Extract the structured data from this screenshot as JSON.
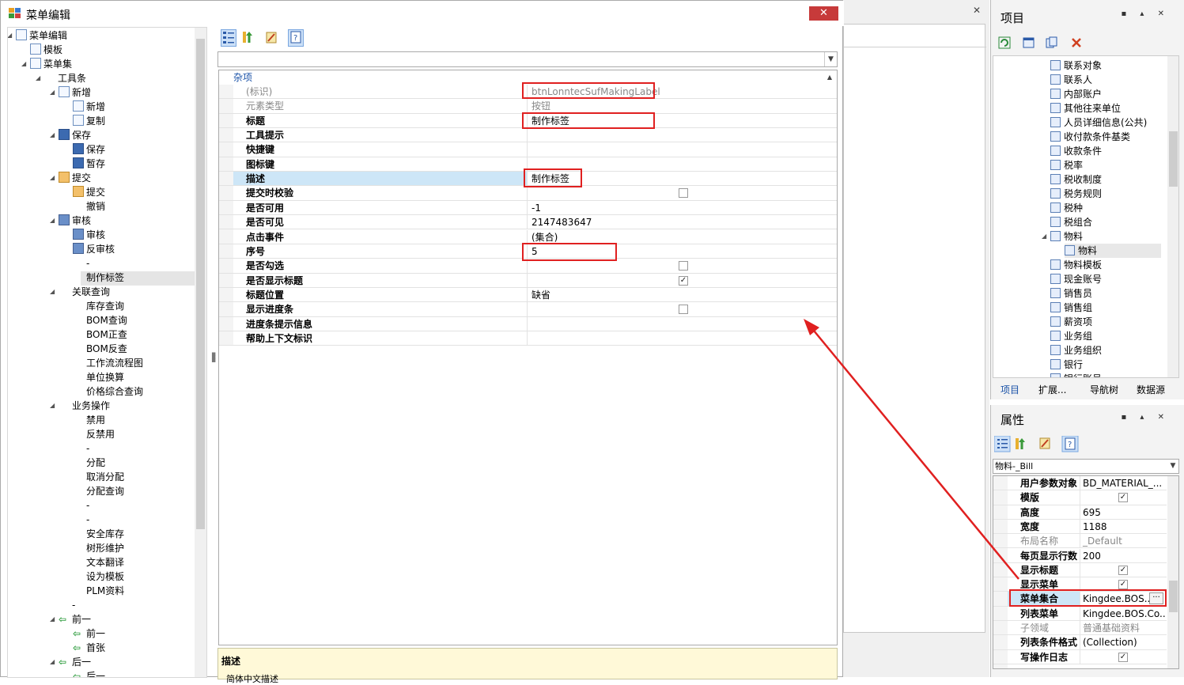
{
  "dialog": {
    "title": "菜单编辑",
    "close": "✕"
  },
  "tree": {
    "root": "菜单编辑",
    "template": "模板",
    "menuset": "菜单集",
    "toolbar": "工具条",
    "groups": [
      {
        "label": "新增",
        "children": [
          "新增",
          "复制"
        ]
      },
      {
        "label": "保存",
        "children": [
          "保存",
          "暂存"
        ]
      },
      {
        "label": "提交",
        "children": [
          "提交",
          "撤销"
        ]
      },
      {
        "label": "审核",
        "children": [
          "审核",
          "反审核",
          "-",
          "制作标签"
        ]
      },
      {
        "label": "关联查询",
        "children": [
          "库存查询",
          "BOM查询",
          "BOM正查",
          "BOM反查",
          "工作流流程图",
          "单位换算",
          "价格综合查询"
        ]
      },
      {
        "label": "业务操作",
        "children": [
          "禁用",
          "反禁用",
          "-",
          "分配",
          "取消分配",
          "分配查询",
          "-",
          "-",
          "安全库存",
          "树形维护",
          "文本翻译",
          "设为模板",
          "PLM资料"
        ]
      },
      {
        "label": "-",
        "children": []
      },
      {
        "label": "前一",
        "children": [
          "前一",
          "首张"
        ]
      },
      {
        "label": "后一",
        "children": [
          "后一"
        ]
      }
    ]
  },
  "property_grid": {
    "category": "杂项",
    "rows": [
      {
        "name": "(标识)",
        "value": "btnLonntecSufMakingLabel",
        "dim": true
      },
      {
        "name": "元素类型",
        "value": "按钮",
        "dim": true
      },
      {
        "name": "标题",
        "value": "制作标签"
      },
      {
        "name": "工具提示",
        "value": ""
      },
      {
        "name": "快捷键",
        "value": ""
      },
      {
        "name": "图标键",
        "value": ""
      },
      {
        "name": "描述",
        "value": "制作标签",
        "selected": true
      },
      {
        "name": "提交时校验",
        "value": "",
        "checkbox": false
      },
      {
        "name": "是否可用",
        "value": "-1"
      },
      {
        "name": "是否可见",
        "value": "2147483647"
      },
      {
        "name": "点击事件",
        "value": "(集合)"
      },
      {
        "name": "序号",
        "value": "5"
      },
      {
        "name": "是否勾选",
        "value": "",
        "checkbox": false
      },
      {
        "name": "是否显示标题",
        "value": "",
        "checkbox": true
      },
      {
        "name": "标题位置",
        "value": "缺省"
      },
      {
        "name": "显示进度条",
        "value": "",
        "checkbox": false
      },
      {
        "name": "进度条提示信息",
        "value": ""
      },
      {
        "name": "帮助上下文标识",
        "value": ""
      }
    ],
    "description_title": "描述",
    "description_text": "简体中文描述"
  },
  "project_panel": {
    "title": "项目",
    "pin_buttons": "▪ ▴ ✕",
    "items": [
      "联系对象",
      "联系人",
      "内部账户",
      "其他往来单位",
      "人员详细信息(公共)",
      "收付款条件基类",
      "收款条件",
      "税率",
      "税收制度",
      "税务规则",
      "税种",
      "税组合",
      "物料",
      "物料",
      "物料模板",
      "现金账号",
      "销售员",
      "销售组",
      "薪资项",
      "业务组",
      "业务组织",
      "银行",
      "银行账号"
    ],
    "tabs": [
      "项目",
      "扩展...",
      "导航树",
      "数据源"
    ]
  },
  "attr_panel": {
    "title": "属性",
    "pin_buttons": "▪ ▴ ✕",
    "object": "物料-_Bill",
    "rows": [
      {
        "name": "用户参数对象",
        "value": "BD_MATERIAL_..."
      },
      {
        "name": "模版",
        "value": "",
        "checkbox": true
      },
      {
        "name": "高度",
        "value": "695"
      },
      {
        "name": "宽度",
        "value": "1188"
      },
      {
        "name": "布局名称",
        "value": "_Default",
        "dim": true
      },
      {
        "name": "每页显示行数",
        "value": "200"
      },
      {
        "name": "显示标题",
        "value": "",
        "checkbox": true
      },
      {
        "name": "显示菜单",
        "value": "",
        "checkbox": true
      },
      {
        "name": "菜单集合",
        "value": "Kingdee.BOS...",
        "selected": true,
        "ellipsis": "···"
      },
      {
        "name": "列表菜单",
        "value": "Kingdee.BOS.Co..."
      },
      {
        "name": "子领域",
        "value": "普通基础资料",
        "dim": true
      },
      {
        "name": "列表条件格式",
        "value": "(Collection)"
      },
      {
        "name": "写操作日志",
        "value": "",
        "checkbox": true
      }
    ]
  },
  "colors": {
    "highlight": "#e02020",
    "accent": "#1a52a8",
    "selection": "#cde6f7"
  }
}
